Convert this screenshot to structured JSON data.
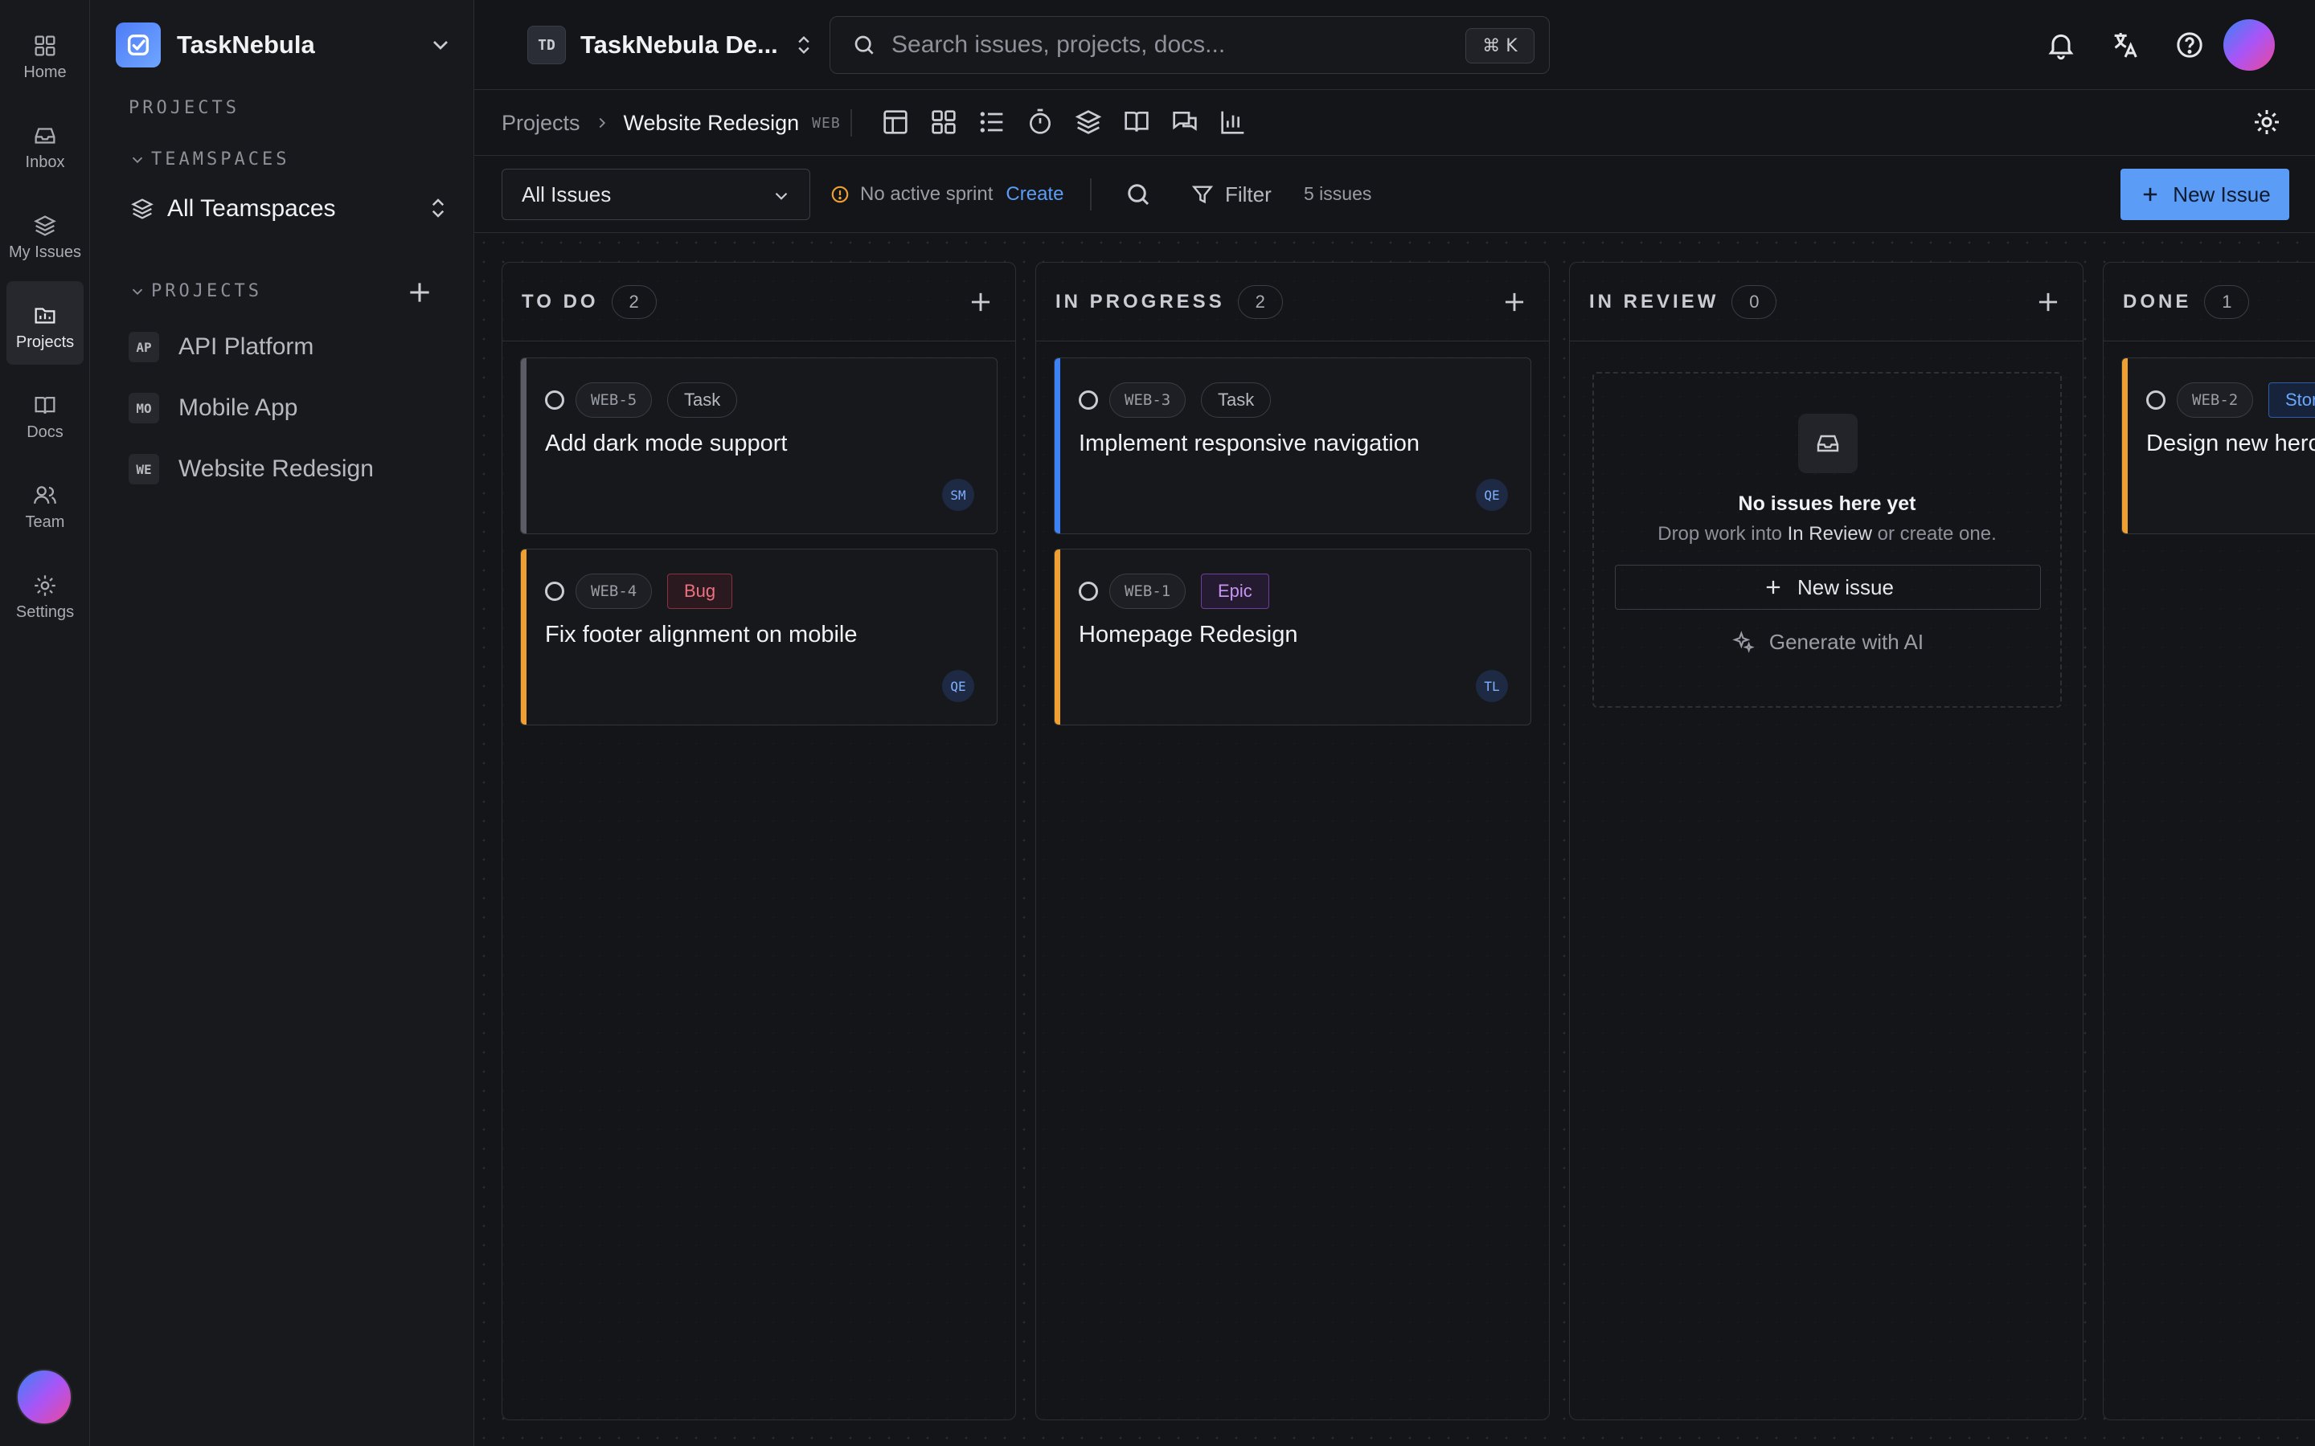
{
  "rail": {
    "items": [
      {
        "label": "Home",
        "icon": "grid-icon"
      },
      {
        "label": "Inbox",
        "icon": "inbox-icon"
      },
      {
        "label": "My Issues",
        "icon": "layers-icon"
      },
      {
        "label": "Projects",
        "icon": "folder-icon",
        "active": true
      },
      {
        "label": "Docs",
        "icon": "book-icon"
      },
      {
        "label": "Team",
        "icon": "users-icon"
      },
      {
        "label": "Settings",
        "icon": "gear-icon"
      }
    ]
  },
  "sidebar": {
    "workspace_name": "TaskNebula",
    "projects_heading": "PROJECTS",
    "teamspaces_heading": "TEAMSPACES",
    "teamspace_selected": "All Teamspaces",
    "projects_subheading": "PROJECTS",
    "projects": [
      {
        "abbr": "AP",
        "name": "API Platform"
      },
      {
        "abbr": "MO",
        "name": "Mobile App"
      },
      {
        "abbr": "WE",
        "name": "Website Redesign"
      }
    ]
  },
  "topbar": {
    "team_badge": "TD",
    "team_name": "TaskNebula De...",
    "search_placeholder": "Search issues, projects, docs...",
    "search_shortcut": "⌘ K"
  },
  "breadcrumb": {
    "root": "Projects",
    "current": "Website Redesign",
    "key": "WEB"
  },
  "toolbar": {
    "view_select": "All Issues",
    "sprint_status": "No active sprint",
    "sprint_create": "Create",
    "filter_label": "Filter",
    "issue_count": "5 issues",
    "new_issue_label": "New Issue"
  },
  "board": {
    "columns": [
      {
        "title": "TO DO",
        "count": "2",
        "cards": [
          {
            "key": "WEB-5",
            "type": "Task",
            "title": "Add dark mode support",
            "assignee": "SM",
            "bar": "#5a5d66"
          },
          {
            "key": "WEB-4",
            "type": "Bug",
            "title": "Fix footer alignment on mobile",
            "assignee": "QE",
            "bar": "#f0a030"
          }
        ]
      },
      {
        "title": "IN PROGRESS",
        "count": "2",
        "cards": [
          {
            "key": "WEB-3",
            "type": "Task",
            "title": "Implement responsive navigation",
            "assignee": "QE",
            "bar": "#3b82f6"
          },
          {
            "key": "WEB-1",
            "type": "Epic",
            "title": "Homepage Redesign",
            "assignee": "TL",
            "bar": "#f0a030"
          }
        ]
      },
      {
        "title": "IN REVIEW",
        "count": "0",
        "empty": {
          "title": "No issues here yet",
          "desc_prefix": "Drop work into ",
          "desc_column": "In Review",
          "desc_suffix": " or create one.",
          "new_issue": "New issue",
          "generate": "Generate with AI"
        }
      },
      {
        "title": "DONE",
        "count": "1",
        "cards": [
          {
            "key": "WEB-2",
            "type": "Story",
            "title": "Design new hero section",
            "assignee": "",
            "bar": "#f0a030"
          }
        ]
      }
    ]
  },
  "colors": {
    "accent": "#5b9cf6",
    "background": "#141519",
    "sidebar": "#18191d"
  }
}
